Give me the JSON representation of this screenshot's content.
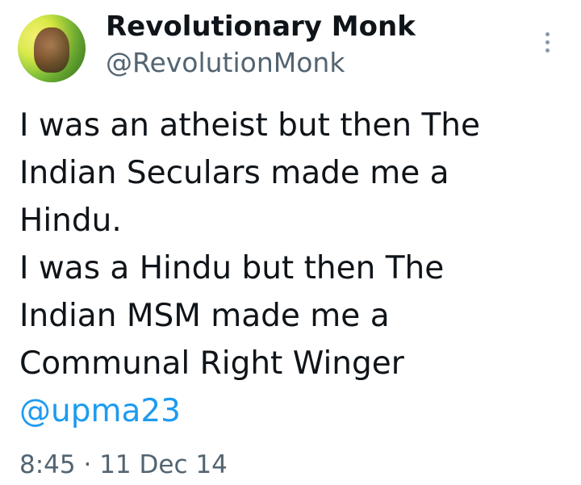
{
  "tweet": {
    "author": {
      "display_name": "Revolutionary Monk",
      "handle": "@RevolutionMonk",
      "avatar_icon": "profile-avatar"
    },
    "more_icon": "more-vertical-icon",
    "text_lines": [
      "I was an atheist but then The",
      "Indian Seculars made me a",
      "Hindu.",
      "I was a Hindu but then The",
      "Indian MSM made me a",
      "Communal Right Winger"
    ],
    "mention": "@upma23",
    "time": "8:45",
    "separator": "·",
    "date": "11 Dec 14",
    "colors": {
      "text": "#0f1419",
      "secondary": "#536471",
      "link": "#1d9bf0"
    }
  }
}
